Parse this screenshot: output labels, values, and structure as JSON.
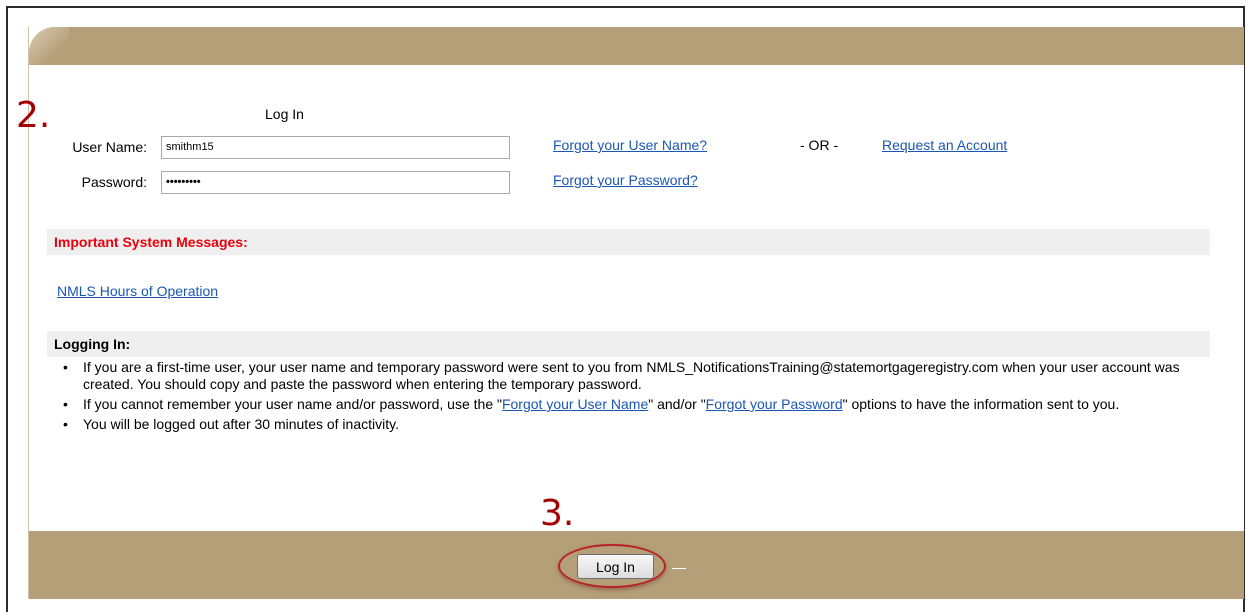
{
  "annotations": {
    "step2": "2.",
    "step3": "3."
  },
  "login": {
    "title": "Log In",
    "username_label": "User Name:",
    "username_value": "smithm15",
    "password_label": "Password:",
    "password_value": "•••••••••"
  },
  "links": {
    "forgot_username": "Forgot your User Name?",
    "or_text": "- OR -",
    "request_account": "Request an Account",
    "forgot_password": "Forgot your Password?"
  },
  "system_messages": {
    "header": "Important System Messages:",
    "hours_link": "NMLS Hours of Operation"
  },
  "logging_in": {
    "header": "Logging In:",
    "bullet_char": "•",
    "bullet1": "If you are a first-time user, your user name and temporary password were sent to you from NMLS_NotificationsTraining@statemortgageregistry.com when your user account was created. You should copy and paste the password when entering the temporary password.",
    "bullet2_prefix": "If you cannot remember your user name and/or password, use the \"",
    "bullet2_link1": "Forgot your User Name",
    "bullet2_middle": "\" and/or \"",
    "bullet2_link2": "Forgot your Password",
    "bullet2_suffix": "\" options to have the information sent to you.",
    "bullet3": "You will be logged out after 30 minutes of inactivity."
  },
  "footer": {
    "login_button": "Log In"
  },
  "colors": {
    "bar": "#b59f79",
    "link": "#1a57b5",
    "alert": "#e8000b",
    "annotation": "#a30000"
  }
}
